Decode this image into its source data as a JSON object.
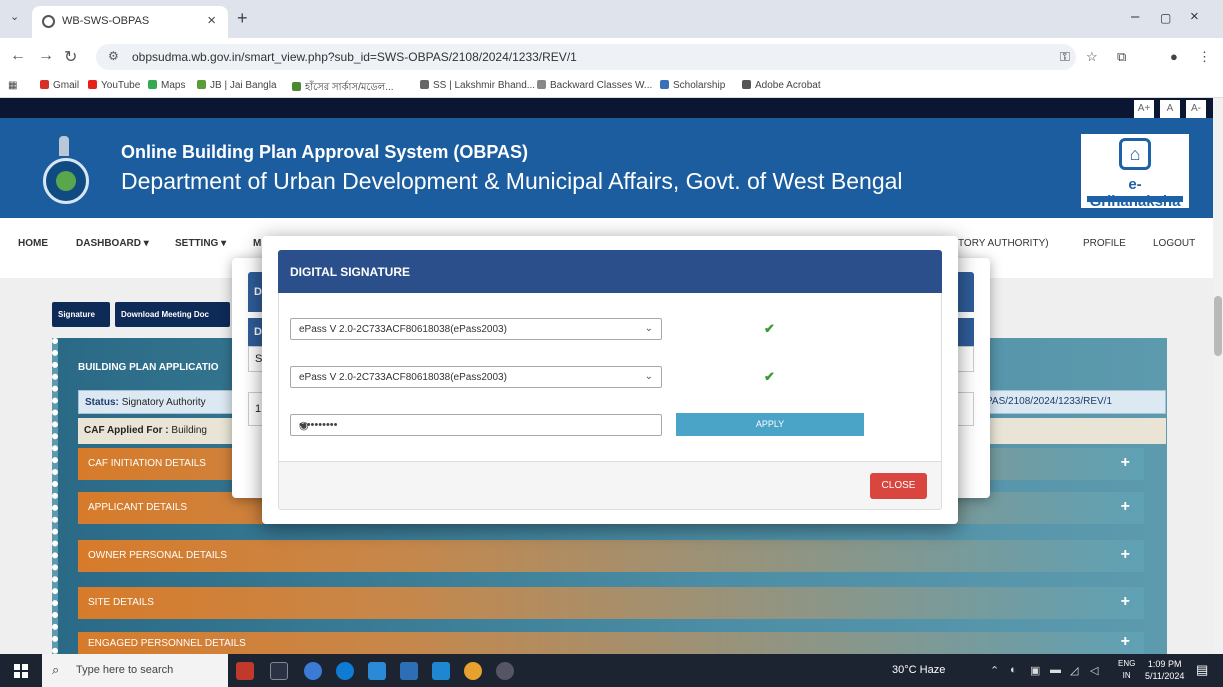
{
  "browser": {
    "tab_title": "WB-SWS-OBPAS",
    "url": "obpsudma.wb.gov.in/smart_view.php?sub_id=SWS-OBPAS/2108/2024/1233/REV/1",
    "bookmarks": [
      "Gmail",
      "YouTube",
      "Maps",
      "JB | Jai Bangla",
      "হাঁসের সার্কাস/মডেল...",
      "SS | Lakshmir Bhand...",
      "Backward Classes W...",
      "Scholarship",
      "Adobe Acrobat"
    ],
    "bookmark_colors": [
      "#d93025",
      "#e62117",
      "#34a853",
      "#5b9b3a",
      "#4b8a33",
      "#666666",
      "#888888",
      "#3a6fb7",
      "#555555"
    ]
  },
  "site": {
    "font_sizes": [
      "A+",
      "A",
      "A-"
    ],
    "title": "Online Building Plan Approval System (OBPAS)",
    "subtitle": "Department of Urban Development & Municipal Affairs, Govt. of West Bengal",
    "logo_text": "e-Grihanaksha",
    "menu": {
      "home": "HOME",
      "dashboard": "DASHBOARD ▾",
      "setting": "SETTING ▾",
      "m": "M",
      "authority": "TORY AUTHORITY)",
      "profile": "PROFILE",
      "logout": "LOGOUT"
    }
  },
  "page": {
    "buttons": [
      "Signature",
      "Download Meeting Doc"
    ],
    "panel_heading": "BUILDING PLAN APPLICATIO",
    "status_label": "Status:",
    "status_value": "Signatory Authority",
    "status_ref": "PAS/2108/2024/1233/REV/1",
    "caf_label": "CAF Applied For :",
    "caf_value": "Building",
    "sections": [
      "CAF INITIATION DETAILS",
      "APPLICANT DETAILS",
      "OWNER PERSONAL DETAILS",
      "SITE DETAILS",
      "ENGAGED PERSONNEL DETAILS"
    ]
  },
  "modal_back": {
    "head_letter": "D",
    "subhead_letter": "D",
    "row1": "S",
    "row2": "1"
  },
  "modal": {
    "title": "DIGITAL SIGNATURE",
    "select1": "ePass V 2.0-2C733ACF80618038(ePass2003)",
    "select2": "ePass V 2.0-2C733ACF80618038(ePass2003)",
    "check": "✔",
    "password_mask": "••••••••••",
    "apply_label": "APPLY",
    "close_label": "CLOSE"
  },
  "taskbar": {
    "search_placeholder": "Type here to search",
    "weather": "30°C  Haze",
    "lang1": "ENG",
    "lang2": "IN",
    "time": "1:09 PM",
    "date": "5/11/2024"
  }
}
